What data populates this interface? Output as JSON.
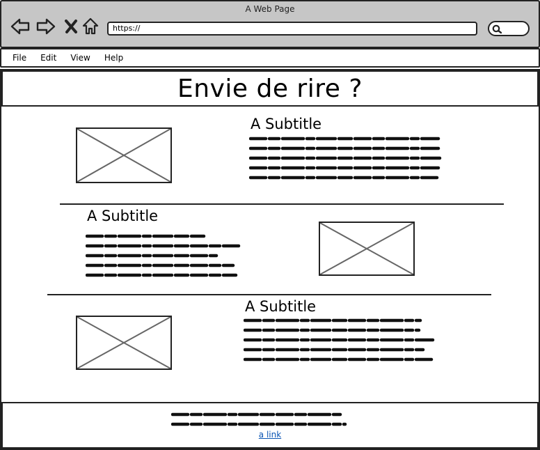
{
  "window": {
    "title": "A Web Page"
  },
  "toolbar": {
    "url": "https://",
    "icons": [
      "back-arrow-icon",
      "forward-arrow-icon",
      "close-x-icon",
      "home-icon",
      "search-icon"
    ]
  },
  "menu": {
    "items": [
      "File",
      "Edit",
      "View",
      "Help"
    ]
  },
  "page": {
    "heading": "Envie de rire ?"
  },
  "sections": [
    {
      "subtitle": "A Subtitle"
    },
    {
      "subtitle": "A Subtitle"
    },
    {
      "subtitle": "A Subtitle"
    }
  ],
  "footer": {
    "link_label": "a link"
  }
}
